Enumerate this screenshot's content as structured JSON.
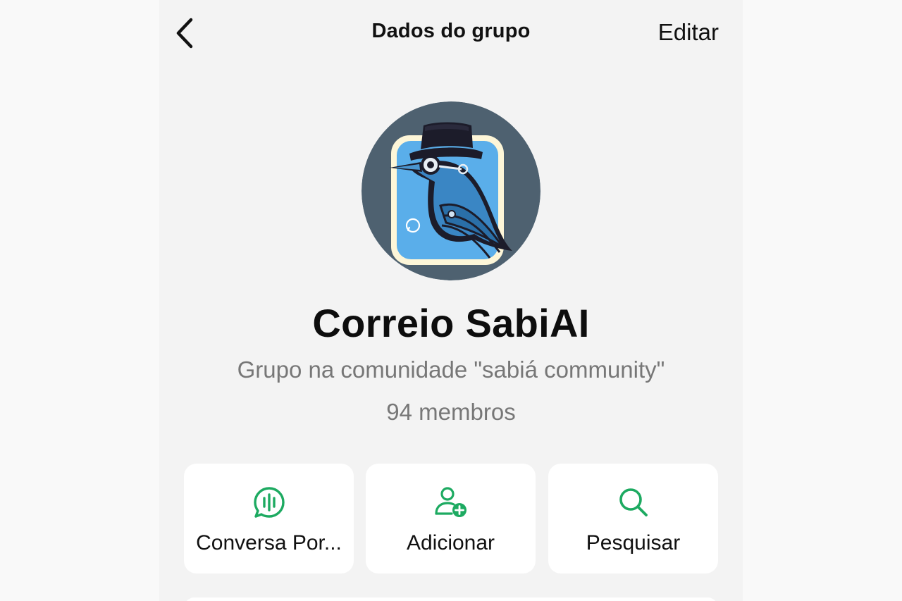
{
  "header": {
    "title": "Dados do grupo",
    "edit_label": "Editar",
    "back_icon": "chevron-left-icon"
  },
  "group": {
    "name": "Correio SabiAI",
    "subtitle": "Grupo na comunidade \"sabiá community\"",
    "members": "94 membros"
  },
  "actions": [
    {
      "label": "Conversa Por...",
      "icon": "voice-chat-icon"
    },
    {
      "label": "Adicionar",
      "icon": "add-person-icon"
    },
    {
      "label": "Pesquisar",
      "icon": "search-icon"
    }
  ],
  "colors": {
    "accent": "#1daa61",
    "background": "#f3f3f3",
    "card": "#ffffff"
  }
}
